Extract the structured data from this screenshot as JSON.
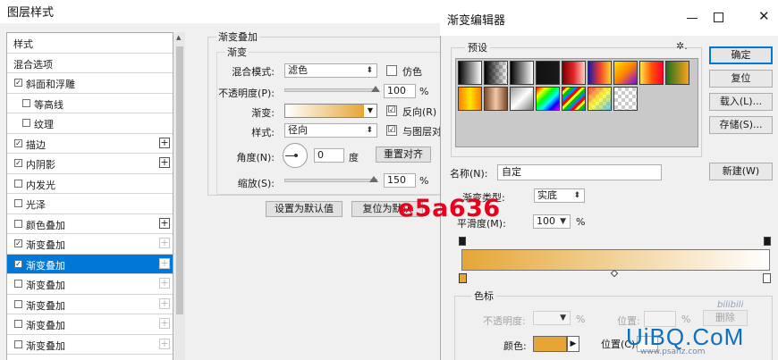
{
  "layer_style": {
    "title": "图层样式",
    "list": [
      {
        "label": "样式",
        "check": "none",
        "plus": "none",
        "indent": 0
      },
      {
        "label": "混合选项",
        "check": "none",
        "plus": "none",
        "indent": 0
      },
      {
        "label": "斜面和浮雕",
        "check": "checked",
        "plus": "none",
        "indent": 0
      },
      {
        "label": "等高线",
        "check": "unchecked",
        "plus": "none",
        "indent": 1
      },
      {
        "label": "纹理",
        "check": "unchecked",
        "plus": "none",
        "indent": 1
      },
      {
        "label": "描边",
        "check": "checked",
        "plus": "active",
        "indent": 0
      },
      {
        "label": "内阴影",
        "check": "checked",
        "plus": "active",
        "indent": 0
      },
      {
        "label": "内发光",
        "check": "unchecked",
        "plus": "none",
        "indent": 0
      },
      {
        "label": "光泽",
        "check": "unchecked",
        "plus": "none",
        "indent": 0
      },
      {
        "label": "颜色叠加",
        "check": "unchecked",
        "plus": "active",
        "indent": 0
      },
      {
        "label": "渐变叠加",
        "check": "checked",
        "plus": "dim",
        "indent": 0
      },
      {
        "label": "渐变叠加",
        "check": "checked",
        "plus": "dim",
        "indent": 0,
        "selected": true
      },
      {
        "label": "渐变叠加",
        "check": "unchecked",
        "plus": "dim",
        "indent": 0
      },
      {
        "label": "渐变叠加",
        "check": "unchecked",
        "plus": "dim",
        "indent": 0
      },
      {
        "label": "渐变叠加",
        "check": "unchecked",
        "plus": "dim",
        "indent": 0
      },
      {
        "label": "渐变叠加",
        "check": "unchecked",
        "plus": "dim",
        "indent": 0
      }
    ],
    "group_title": "渐变叠加",
    "subgroup_title": "渐变",
    "blend_mode_label": "混合模式:",
    "blend_mode_value": "滤色",
    "dither_label": "仿色",
    "opacity_label": "不透明度(P):",
    "opacity_value": "100",
    "opacity_fraction": 1.0,
    "percent": "%",
    "gradient_label": "渐变:",
    "reverse_label": "反向(R)",
    "style_label": "样式:",
    "style_value": "径向",
    "align_label": "与图层对",
    "angle_label": "角度(N):",
    "angle_value": "0",
    "degree": "度",
    "reset_align_button": "重置对齐",
    "scale_label": "缩放(S):",
    "scale_value": "150",
    "scale_fraction": 0.98,
    "make_default_button": "设置为默认值",
    "reset_default_button": "复位为默认"
  },
  "overlay_hex": "e5a636",
  "gradient_editor": {
    "title": "渐变编辑器",
    "presets_label": "预设",
    "gear": "✲.",
    "buttons": {
      "ok": "确定",
      "reset": "复位",
      "load": "载入(L)...",
      "save": "存储(S)...",
      "new": "新建(W)"
    },
    "name_label": "名称(N):",
    "name_value": "自定",
    "gradient_type_label": "渐变类型:",
    "gradient_type_value": "实底",
    "smoothness_label": "平滑度(M):",
    "smoothness_value": "100",
    "percent": "%",
    "stops_label": "色标",
    "opacity_label": "不透明度:",
    "location_label": "位置:",
    "delete_button": "删除",
    "color_label": "颜色:",
    "location2_label": "位置(C):",
    "stop_color": "#e5a636"
  },
  "watermark": {
    "line1": "bilibili",
    "brand": "UiBQ.CoM",
    "url": "www.psahz.com"
  },
  "colors": {
    "accent": "#0078d7",
    "gradient_start": "#e5a636",
    "gradient_end": "#ffffff",
    "overlay_text": "#e8001e"
  }
}
